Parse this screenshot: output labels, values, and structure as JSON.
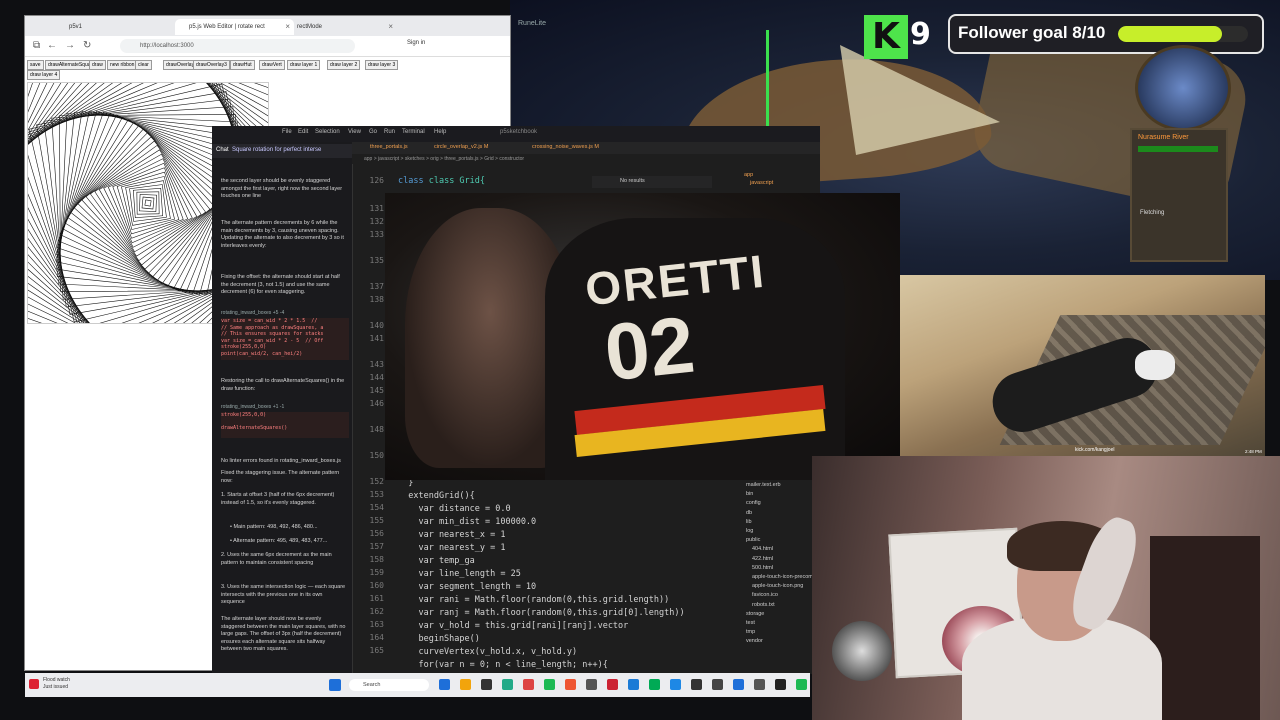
{
  "game": {
    "title": "RuneLite"
  },
  "follower_goal": {
    "logo": "K",
    "count": "9",
    "label": "Follower goal 8/10",
    "progress": 0.8,
    "bar_color": "#c7ee2a"
  },
  "rs_panel": {
    "title": "Nurasume River",
    "skill": "Fletching"
  },
  "browser": {
    "tabs": [
      {
        "label": "p5v1"
      },
      {
        "label": "p5.js Web Editor | rotate rect"
      },
      {
        "label": "rectMode"
      }
    ],
    "url": "http://localhost:3000",
    "signin": "Sign in",
    "buttons": [
      "save",
      "drawAlternateSquares",
      "draw",
      "new ribbon",
      "clear",
      "drawOverlay",
      "drawOverlay3",
      "drawHut",
      "drawVert",
      "draw layer 1",
      "draw layer 2",
      "draw layer 3",
      "draw layer 4"
    ]
  },
  "vscode": {
    "menu": [
      "File",
      "Edit",
      "Selection",
      "View",
      "Go",
      "Run",
      "Terminal",
      "Help"
    ],
    "window_title": "p5sketchbook",
    "chat": {
      "tab": "Chat",
      "title": "Square rotation for perfect interse",
      "paragraphs": [
        "the second layer should be evenly staggered amongst the first layer, right now the second layer touches one line",
        "The alternate pattern decrements by 6 while the main decrements by 3, causing uneven spacing. Updating the alternate to also decrement by 3 so it interleaves evenly:",
        "Fixing the offset: the alternate should start at half the decrement (3, not 1.5) and use the same decrement (6) for even staggering.",
        "Restoring the call to drawAlternateSquares() in the draw function:",
        "No linter errors found in rotating_inward_boxes.js",
        "Fixed the staggering issue. The alternate pattern now:"
      ],
      "file1": "rotating_inward_boxes +5 -4",
      "code1": "var size = can_wid * 2 * 1.5  //\n// Same approach as drawSquares, a\n// This ensures squares for stacks\nvar size = can_wid * 2 - 5  // Off\nstroke(255,0,0)\npoint(can_wid/2, can_hei/2)",
      "file2": "rotating_inward_boxes +1 -1",
      "code2": "stroke(255,0,0)\n\ndrawAlternateSquares()",
      "list": [
        "1. Starts at offset 3 (half of the 6px decrement) instead of 1.5, so it's evenly staggered.",
        "• Main pattern: 498, 492, 486, 480...",
        "• Alternate pattern: 495, 489, 483, 477...",
        "2. Uses the same 6px decrement as the main pattern to maintain consistent spacing",
        "3. Uses the same intersection logic — each square intersects with the previous one in its own sequence",
        "The alternate layer should now be evenly staggered between the main layer squares, with no large gaps. The offset of 3px (half the decrement) ensures each alternate square sits halfway between two main squares."
      ]
    },
    "editor_tabs": [
      "three_portals.js",
      "circle_overlap_v2.js M",
      "crossing_noise_waves.js M"
    ],
    "breadcrumb": "app > javascript > sketches > orig > three_portals.js > Grid > constructor",
    "find": "No results",
    "line_numbers": [
      "126",
      "131",
      "132",
      "133",
      "135",
      "137",
      "138",
      "140",
      "141",
      "143",
      "144",
      "145",
      "146",
      "148",
      "150",
      "152",
      "153",
      "154",
      "155",
      "156",
      "157",
      "158",
      "159",
      "160",
      "161",
      "162",
      "163",
      "164",
      "165"
    ],
    "code_top": "class Grid{",
    "code_lines": [
      "  }",
      "  extendGrid(){",
      "    var distance = 0.0",
      "    var min_dist = 100000.0",
      "    var nearest_x = 1",
      "    var nearest_y = 1",
      "    var temp_ga",
      "    var line_length = 25",
      "    var segment_length = 10",
      "    var rani = Math.floor(random(0,this.grid.length))",
      "    var ranj = Math.floor(random(0,this.grid[0].length))",
      "    var v_hold = this.grid[rani][ranj].vector",
      "    beginShape()",
      "    curveVertex(v_hold.x, v_hold.y)",
      "    for(var n = 0; n < line_length; n++){"
    ],
    "explorer_top": [
      "app",
      "javascript"
    ],
    "explorer": [
      "mailer.text.erb",
      "bin",
      "config",
      "db",
      "lib",
      "log",
      "public",
      "404.html",
      "422.html",
      "500.html",
      "apple-touch-icon-precom",
      "apple-touch-icon.png",
      "favicon.ico",
      "robots.txt",
      "storage",
      "test",
      "tmp",
      "vendor"
    ]
  },
  "video": {
    "jersey_text": "ORETTI",
    "jersey_number": "02"
  },
  "outcam": {
    "footer": "kick.com/kangjoel",
    "clock": "2:48 PM"
  },
  "taskbar": {
    "weather_line1": "Flood watch",
    "weather_line2": "Just issued",
    "search": "Search",
    "icon_colors": [
      "#1e6fd9",
      "#f2a40c",
      "#333",
      "#2a8",
      "#d44",
      "#1db954",
      "#e53",
      "#555",
      "#c23",
      "#1a7bd6",
      "#0a5",
      "#1e88e5",
      "#333",
      "#444",
      "#1e6fd9",
      "#555",
      "#222",
      "#1db954"
    ]
  }
}
